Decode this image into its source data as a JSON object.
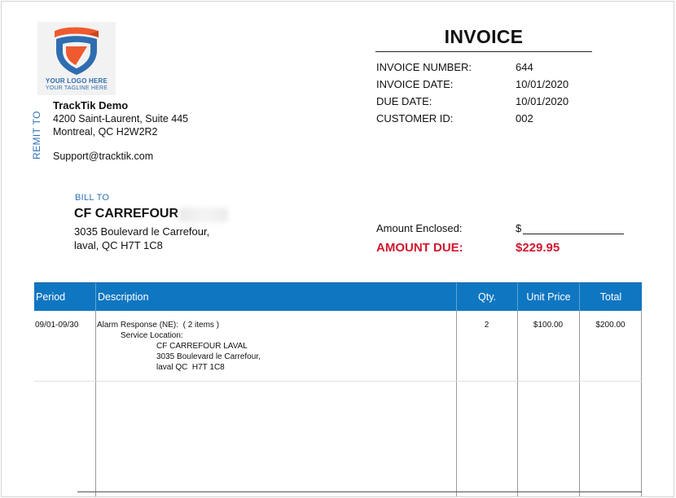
{
  "logo": {
    "line1": "YOUR LOGO HERE",
    "line2": "YOUR TAGLINE HERE",
    "colors": {
      "orange": "#ef5a2e",
      "blue": "#2f6db0"
    }
  },
  "remit": {
    "label": "REMIT TO",
    "company": "TrackTik Demo",
    "address1": "4200 Saint-Laurent, Suite 445",
    "address2": "Montreal, QC H2W2R2",
    "email": "Support@tracktik.com"
  },
  "invoice": {
    "title": "INVOICE",
    "fields": [
      {
        "label": "INVOICE NUMBER:",
        "value": "644"
      },
      {
        "label": "INVOICE DATE:",
        "value": "10/01/2020"
      },
      {
        "label": "DUE DATE:",
        "value": "10/01/2020"
      },
      {
        "label": "CUSTOMER ID:",
        "value": "002"
      }
    ]
  },
  "bill_to": {
    "label": "BILL TO",
    "name": "CF CARREFOUR",
    "address1": "3035 Boulevard le Carrefour,",
    "address2": "laval, QC H7T 1C8"
  },
  "amounts": {
    "enclosed_label": "Amount Enclosed:",
    "enclosed_value": "$",
    "due_label": "AMOUNT DUE:",
    "due_value": "$229.95",
    "due_color": "#d0182f"
  },
  "table": {
    "header_color": "#0f76c1",
    "headers": {
      "period": "Period",
      "description": "Description",
      "qty": "Qty.",
      "unit_price": "Unit Price",
      "total": "Total"
    },
    "rows": [
      {
        "period": "09/01-09/30",
        "desc_main": "Alarm Response (NE):  ( 2 items )",
        "desc_loc_label": "Service Location:",
        "desc_loc_name": "CF CARREFOUR LAVAL",
        "desc_loc_addr1": "3035 Boulevard le Carrefour,",
        "desc_loc_addr2": "laval QC  H7T 1C8",
        "qty": "2",
        "unit_price": "$100.00",
        "total": "$200.00"
      }
    ]
  }
}
